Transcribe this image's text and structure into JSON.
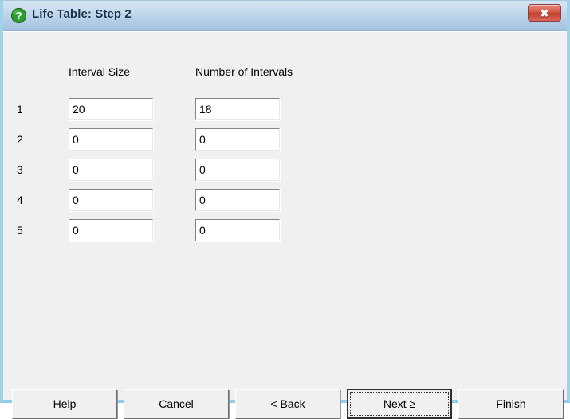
{
  "window": {
    "title": "Life Table: Step 2",
    "icon": "question-mark-icon",
    "close_label": "✖",
    "accent_title_color": "#17314d",
    "close_button_color": "#c2402f",
    "frame_color": "#9fd3ea",
    "client_background": "#f0f0f0"
  },
  "table": {
    "headers": {
      "interval_size": "Interval Size",
      "number_of_intervals": "Number of Intervals"
    },
    "rows": [
      {
        "label": "1",
        "interval_size": "20",
        "number_of_intervals": "18"
      },
      {
        "label": "2",
        "interval_size": "0",
        "number_of_intervals": "0"
      },
      {
        "label": "3",
        "interval_size": "0",
        "number_of_intervals": "0"
      },
      {
        "label": "4",
        "interval_size": "0",
        "number_of_intervals": "0"
      },
      {
        "label": "5",
        "interval_size": "0",
        "number_of_intervals": "0"
      }
    ]
  },
  "buttons": {
    "help": {
      "accel": "H",
      "rest": "elp"
    },
    "cancel": {
      "accel": "C",
      "rest": "ancel"
    },
    "back": {
      "accel": "<",
      "rest": " Back"
    },
    "next": {
      "accel": "N",
      "rest": "ext ≥",
      "focused": true
    },
    "finish": {
      "accel": "F",
      "rest": "inish"
    }
  }
}
